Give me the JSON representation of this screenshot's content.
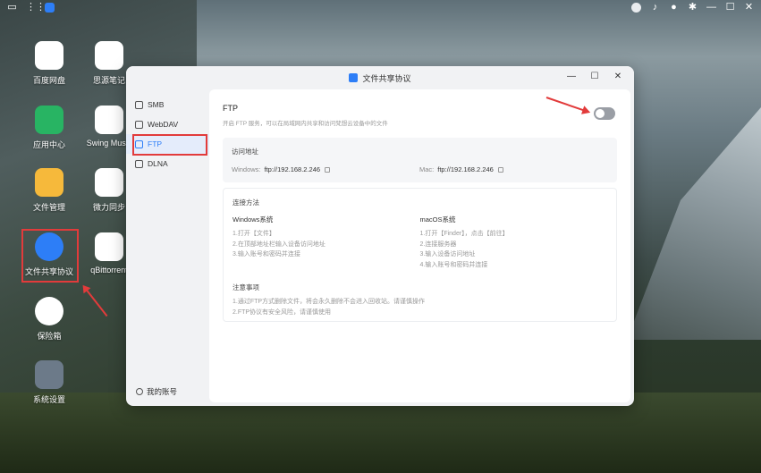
{
  "topbar": {
    "left_icons": [
      "monitor-icon",
      "grid-icon",
      "app-icon"
    ],
    "right_icons": [
      "account-circle-icon",
      "bell-icon",
      "user-icon",
      "settings-icon",
      "minimize-icon",
      "maximize-icon",
      "close-icon"
    ]
  },
  "desktop": {
    "icons": [
      {
        "label": "百度网盘",
        "icon": "baidu-netdisk-icon",
        "color": "#ffffff"
      },
      {
        "label": "思源笔记",
        "icon": "siyuan-note-icon",
        "color": "#ffffff"
      },
      {
        "label": "应用中心",
        "icon": "app-center-icon",
        "color": "#28b463"
      },
      {
        "label": "Swing Music",
        "icon": "swing-music-icon",
        "color": "#ffffff"
      },
      {
        "label": "文件管理",
        "icon": "folder-icon",
        "color": "#f6b93b"
      },
      {
        "label": "微力同步",
        "icon": "verysync-icon",
        "color": "#ffffff"
      },
      {
        "label": "文件共享协议",
        "icon": "file-share-icon",
        "color": "#2d7ef7"
      },
      {
        "label": "qBittorrent",
        "icon": "qbittorrent-icon",
        "color": "#ffffff"
      },
      {
        "label": "保险箱",
        "icon": "safe-icon",
        "color": "#ffffff"
      },
      {
        "label": "系统设置",
        "icon": "system-settings-icon",
        "color": "#6c7a89"
      }
    ]
  },
  "window": {
    "title": "文件共享协议",
    "controls": {
      "minimize": "—",
      "maximize": "☐",
      "close": "✕"
    },
    "sidebar": {
      "items": [
        {
          "label": "SMB",
          "icon": "smb-icon"
        },
        {
          "label": "WebDAV",
          "icon": "webdav-icon"
        },
        {
          "label": "FTP",
          "icon": "ftp-icon"
        },
        {
          "label": "DLNA",
          "icon": "dlna-icon"
        }
      ],
      "account_label": "我的账号"
    },
    "ftp": {
      "title": "FTP",
      "description": "开启 FTP 服务，可以在局域网内共享和访问梵想云设备中的文件",
      "enabled": false
    },
    "access": {
      "title": "访问地址",
      "windows_key": "Windows:",
      "windows_value": "ftp://192.168.2.246",
      "mac_key": "Mac:",
      "mac_value": "ftp://192.168.2.246"
    },
    "method": {
      "title": "连接方法",
      "windows_title": "Windows系统",
      "windows_steps": [
        "1.打开【文件】",
        "2.在顶部地址栏输入设备访问地址",
        "3.输入账号和密码并连接"
      ],
      "mac_title": "macOS系统",
      "mac_steps": [
        "1.打开【Finder】，点击【前往】",
        "2.连接服务器",
        "3.输入设备访问地址",
        "4.输入账号和密码并连接"
      ],
      "notice_title": "注意事项",
      "notices": [
        "1.通过FTP方式删除文件，将会永久删除不会进入回收站。请谨慎操作",
        "2.FTP协议有安全风险，请谨慎使用"
      ]
    }
  },
  "colors": {
    "accent": "#2d7ef7",
    "highlight": "#e23b3b"
  }
}
